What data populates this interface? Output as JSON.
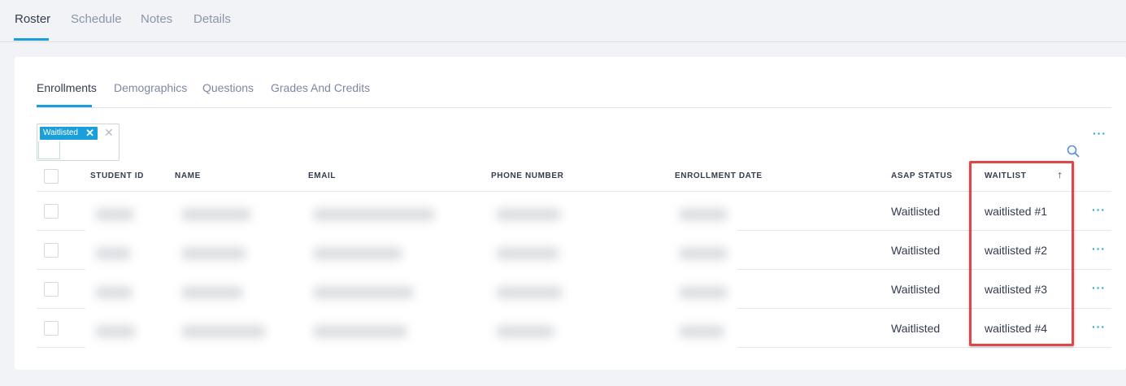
{
  "top_tabs": [
    {
      "label": "Roster",
      "active": true
    },
    {
      "label": "Schedule",
      "active": false
    },
    {
      "label": "Notes",
      "active": false
    },
    {
      "label": "Details",
      "active": false
    }
  ],
  "sub_tabs": [
    {
      "label": "Enrollments",
      "active": true
    },
    {
      "label": "Demographics",
      "active": false
    },
    {
      "label": "Questions",
      "active": false
    },
    {
      "label": "Grades And Credits",
      "active": false
    }
  ],
  "filter": {
    "chip_label": "Waitlisted",
    "chip_remove_icon": "close-icon",
    "clear_icon": "close-icon"
  },
  "toolbar": {
    "more_icon": "more-horizontal-icon",
    "search_icon": "search-icon"
  },
  "table": {
    "columns": [
      "STUDENT ID",
      "NAME",
      "EMAIL",
      "PHONE NUMBER",
      "ENROLLMENT DATE",
      "ASAP STATUS",
      "WAITLIST"
    ],
    "sorted_column": "WAITLIST",
    "sort_direction": "ascending",
    "rows": [
      {
        "asap_status": "Waitlisted",
        "waitlist": "waitlisted #1"
      },
      {
        "asap_status": "Waitlisted",
        "waitlist": "waitlisted #2"
      },
      {
        "asap_status": "Waitlisted",
        "waitlist": "waitlisted #3"
      },
      {
        "asap_status": "Waitlisted",
        "waitlist": "waitlisted #4"
      }
    ]
  },
  "colors": {
    "accent": "#1a9fda",
    "highlight": "#e0454a",
    "text": "#333c4e",
    "muted": "#8b95aa"
  }
}
